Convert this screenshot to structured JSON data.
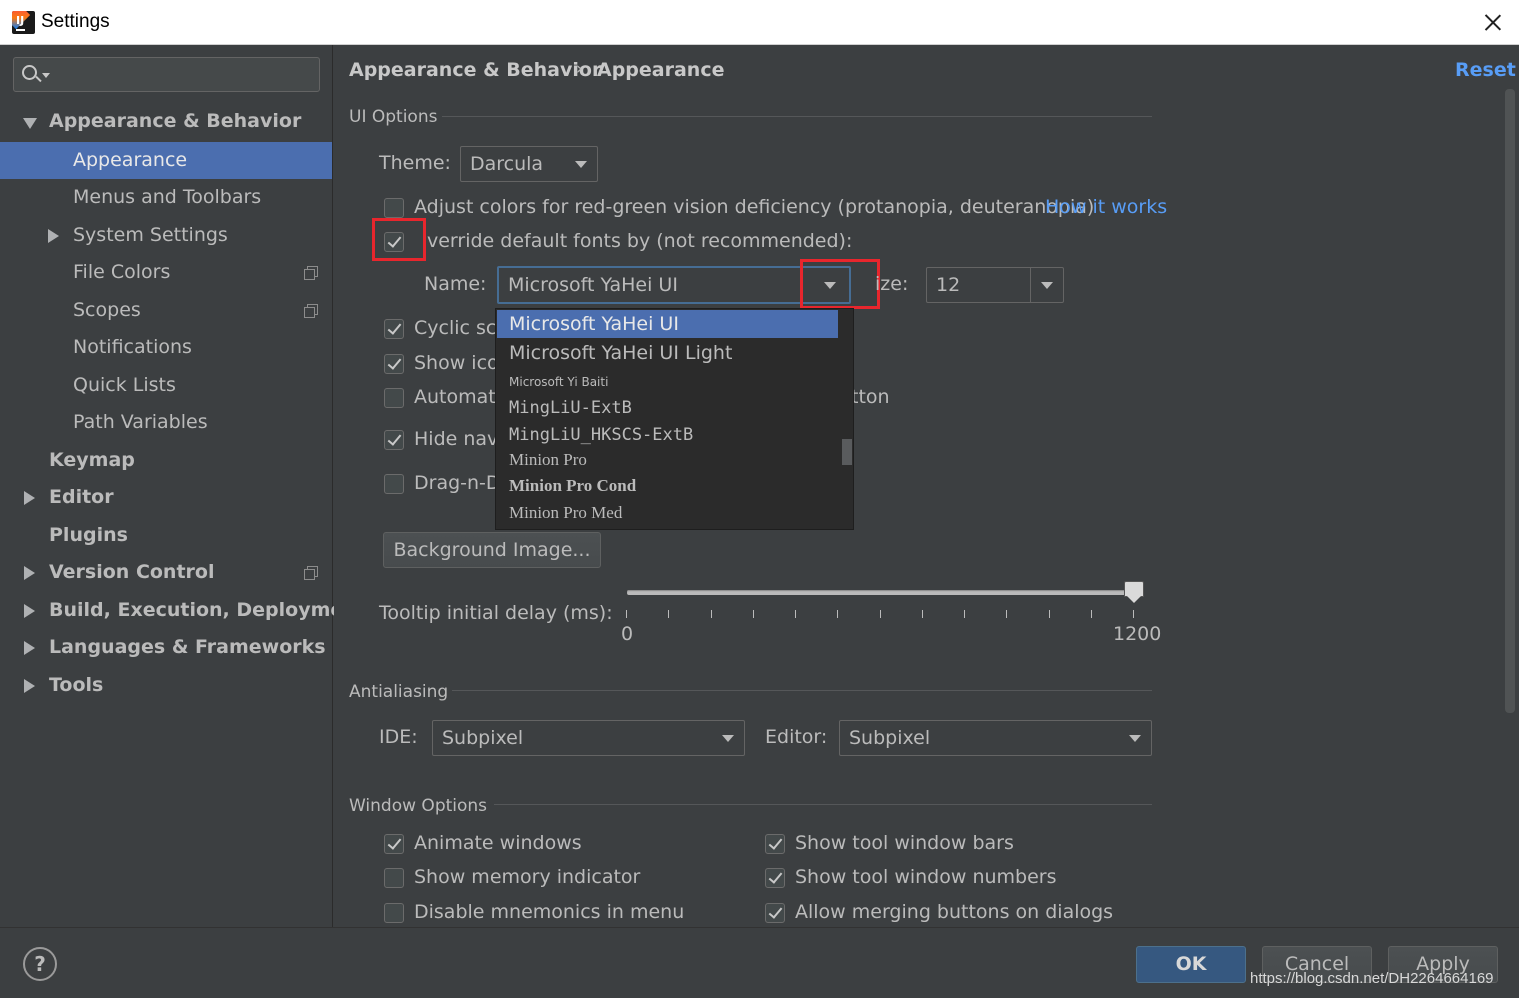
{
  "window": {
    "title": "Settings"
  },
  "sidebar": {
    "items": [
      {
        "label": "Appearance & Behavior",
        "level": 0,
        "expanded": true,
        "bold": true
      },
      {
        "label": "Appearance",
        "level": 1,
        "selected": true
      },
      {
        "label": "Menus and Toolbars",
        "level": 1
      },
      {
        "label": "System Settings",
        "level": 1,
        "collapsed": true
      },
      {
        "label": "File Colors",
        "level": 1,
        "copy_icon": true
      },
      {
        "label": "Scopes",
        "level": 1,
        "copy_icon": true
      },
      {
        "label": "Notifications",
        "level": 1
      },
      {
        "label": "Quick Lists",
        "level": 1
      },
      {
        "label": "Path Variables",
        "level": 1
      },
      {
        "label": "Keymap",
        "level": 0,
        "bold": true
      },
      {
        "label": "Editor",
        "level": 0,
        "collapsed": true,
        "bold": true
      },
      {
        "label": "Plugins",
        "level": 0,
        "bold": true
      },
      {
        "label": "Version Control",
        "level": 0,
        "collapsed": true,
        "bold": true,
        "copy_icon": true
      },
      {
        "label": "Build, Execution, Deployment",
        "level": 0,
        "collapsed": true,
        "bold": true
      },
      {
        "label": "Languages & Frameworks",
        "level": 0,
        "collapsed": true,
        "bold": true
      },
      {
        "label": "Tools",
        "level": 0,
        "collapsed": true,
        "bold": true
      }
    ]
  },
  "breadcrumb": {
    "parent": "Appearance & Behavior",
    "sep": "›",
    "current": "Appearance"
  },
  "reset_label": "Reset",
  "ui_options": {
    "title": "UI Options",
    "theme_label": "Theme:",
    "theme_value": "Darcula",
    "adjust_colors_label": "Adjust colors for red-green vision deficiency (protanopia, deuteranopia)",
    "adjust_colors_checked": false,
    "how_it_works": "How it works",
    "override_fonts_label": "verride default fonts by (not recommended):",
    "override_fonts_checked": true,
    "name_label": "Name:",
    "font_name": "Microsoft YaHei UI",
    "size_label": "ize:",
    "font_size": "12",
    "cyclic_label": "Cyclic scr",
    "cyclic_checked": true,
    "show_icons_label": "Show icor",
    "show_icons_checked": true,
    "automatic_label": "Automati",
    "automatic_tail": "tton",
    "automatic_checked": false,
    "hide_nav_label": "Hide navi",
    "hide_nav_checked": true,
    "drag_label": "Drag-n-D",
    "drag_checked": false,
    "background_image_button": "Background Image...",
    "tooltip_label": "Tooltip initial delay (ms):",
    "tooltip_min": "0",
    "tooltip_max": "1200",
    "tooltip_value": 1200
  },
  "font_dropdown": {
    "options": [
      {
        "label": "Microsoft YaHei UI",
        "selected": true
      },
      {
        "label": "Microsoft YaHei UI Light"
      },
      {
        "label": "Microsoft  Yi  Baiti"
      },
      {
        "label": "MingLiU-ExtB"
      },
      {
        "label": "MingLiU_HKSCS-ExtB"
      },
      {
        "label": "Minion Pro"
      },
      {
        "label": "Minion Pro Cond"
      },
      {
        "label": "Minion Pro Med"
      }
    ]
  },
  "antialiasing": {
    "title": "Antialiasing",
    "ide_label": "IDE:",
    "ide_value": "Subpixel",
    "editor_label": "Editor:",
    "editor_value": "Subpixel"
  },
  "window_options": {
    "title": "Window Options",
    "animate_windows": "Animate windows",
    "animate_windows_checked": true,
    "show_memory": "Show memory indicator",
    "show_memory_checked": false,
    "disable_mnemonics": "Disable mnemonics in menu",
    "disable_mnemonics_checked": false,
    "show_tool_bars": "Show tool window bars",
    "show_tool_bars_checked": true,
    "show_tool_numbers": "Show tool window numbers",
    "show_tool_numbers_checked": true,
    "allow_merging": "Allow merging buttons on dialogs",
    "allow_merging_checked": true
  },
  "footer": {
    "help": "?",
    "ok": "OK",
    "cancel": "Cancel",
    "apply": "Apply",
    "watermark": "https://blog.csdn.net/DH2264664169"
  },
  "colors": {
    "background": "#3c3f41",
    "selection": "#4b6eaf",
    "link": "#589df6",
    "highlight": "#e8262d",
    "ok_button": "#365880"
  }
}
